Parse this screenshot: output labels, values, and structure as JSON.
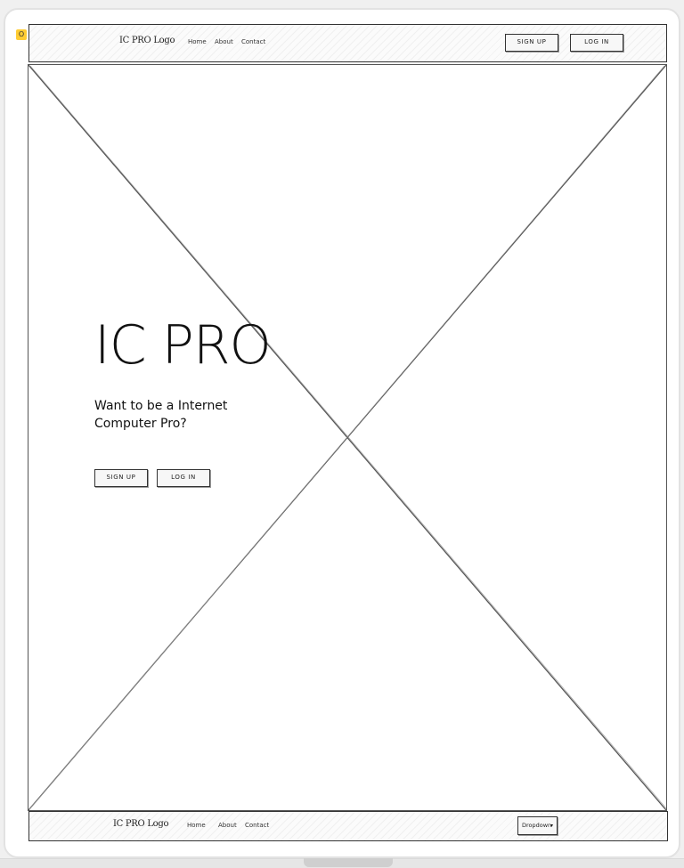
{
  "corner_badge": "O",
  "header": {
    "logo": "IC PRO Logo",
    "nav": [
      "Home",
      "About",
      "Contact"
    ],
    "signup_label": "SIGN UP",
    "login_label": "LOG IN"
  },
  "hero": {
    "title": "IC PRO",
    "tagline": "Want to be a Internet Computer Pro?",
    "signup_label": "SIGN UP",
    "login_label": "LOG IN"
  },
  "footer": {
    "logo": "IC PRO Logo",
    "nav": [
      "Home",
      "About",
      "Contact"
    ],
    "dropdown_label": "Dropdown",
    "dropdown_arrow": "▾"
  }
}
